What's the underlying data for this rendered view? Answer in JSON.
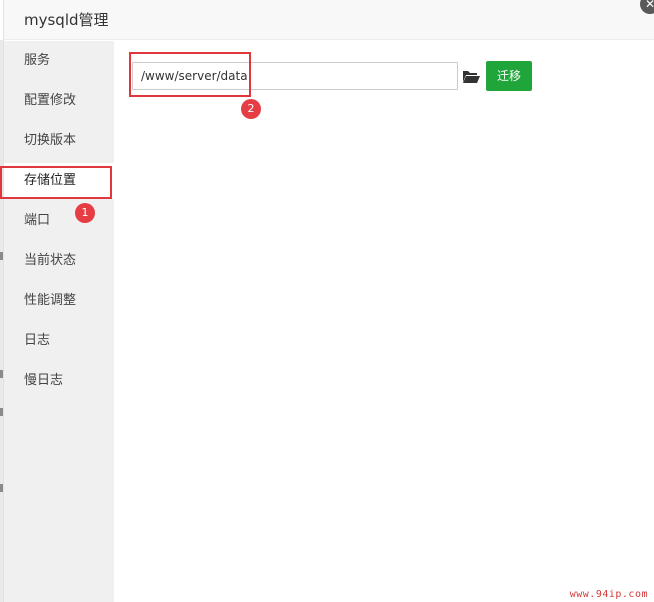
{
  "dialog": {
    "title": "mysqld管理",
    "close_glyph": "✕"
  },
  "sidebar": {
    "items": [
      {
        "label": "服务"
      },
      {
        "label": "配置修改"
      },
      {
        "label": "切换版本"
      },
      {
        "label": "存储位置",
        "active": true
      },
      {
        "label": "端口"
      },
      {
        "label": "当前状态"
      },
      {
        "label": "性能调整"
      },
      {
        "label": "日志"
      },
      {
        "label": "慢日志"
      }
    ]
  },
  "storage": {
    "path_value": "/www/server/data",
    "folder_icon": "folder-open-icon",
    "migrate_label": "迁移"
  },
  "annotations": {
    "badge_1": "1",
    "badge_2": "2"
  },
  "watermark": "www.94ip.com",
  "colors": {
    "primary_green": "#20a53a",
    "annotation_red": "#e0373c",
    "sidebar_bg": "#f0f0f0",
    "title_bg": "#f8f8f8"
  }
}
